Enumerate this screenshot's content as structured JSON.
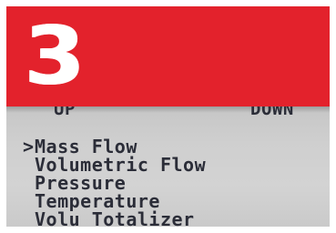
{
  "step": {
    "number": "3",
    "banner_color": "#e3222c"
  },
  "softkeys": {
    "left_label": "UP",
    "right_label": "DOWN"
  },
  "menu": {
    "cursor": ">",
    "items": [
      {
        "label": "Mass Flow",
        "selected": true
      },
      {
        "label": "Volumetric Flow",
        "selected": false
      },
      {
        "label": "Pressure",
        "selected": false
      },
      {
        "label": "Temperature",
        "selected": false
      },
      {
        "label": "Volu Totalizer",
        "selected": false
      }
    ]
  }
}
